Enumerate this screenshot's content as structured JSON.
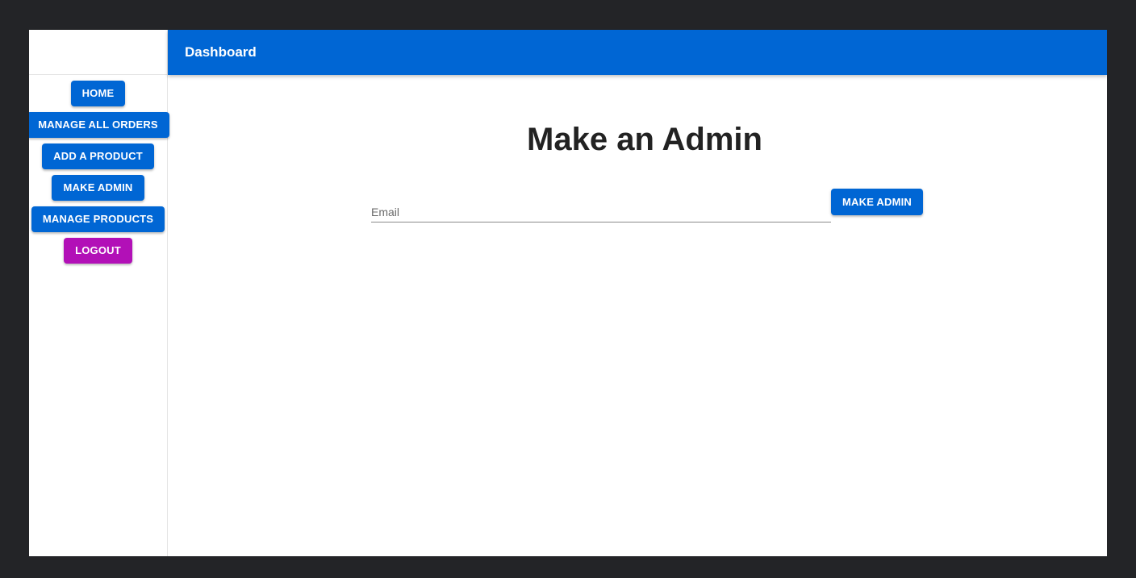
{
  "appbar": {
    "title": "Dashboard"
  },
  "sidebar": {
    "items": [
      {
        "label": "HOME"
      },
      {
        "label": "MANAGE ALL ORDERS"
      },
      {
        "label": "ADD A PRODUCT"
      },
      {
        "label": "MAKE ADMIN"
      },
      {
        "label": "MANAGE PRODUCTS"
      },
      {
        "label": "LOGOUT"
      }
    ]
  },
  "main": {
    "title": "Make an Admin",
    "email": {
      "placeholder": "Email",
      "value": ""
    },
    "submit_label": "MAKE ADMIN"
  },
  "colors": {
    "primary": "#0066d4",
    "logout": "#b210b7",
    "background": "#232427"
  }
}
